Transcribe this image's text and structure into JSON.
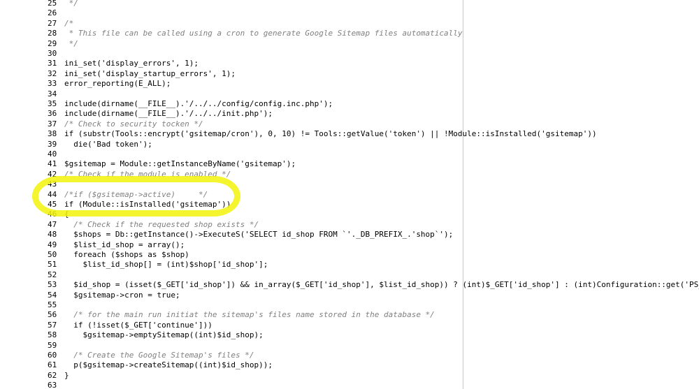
{
  "editor": {
    "lines": [
      {
        "n": "25",
        "text": " */"
      },
      {
        "n": "26",
        "text": ""
      },
      {
        "n": "27",
        "text": "/*"
      },
      {
        "n": "28",
        "text": " * This file can be called using a cron to generate Google Sitemap files automatically"
      },
      {
        "n": "29",
        "text": " */"
      },
      {
        "n": "30",
        "text": ""
      },
      {
        "n": "31",
        "text": "ini_set('display_errors', 1);"
      },
      {
        "n": "32",
        "text": "ini_set('display_startup_errors', 1);"
      },
      {
        "n": "33",
        "text": "error_reporting(E_ALL);"
      },
      {
        "n": "34",
        "text": ""
      },
      {
        "n": "35",
        "text": "include(dirname(__FILE__).'/../../config/config.inc.php');"
      },
      {
        "n": "36",
        "text": "include(dirname(__FILE__).'/../../init.php');"
      },
      {
        "n": "37",
        "text": "/* Check to security tocken */"
      },
      {
        "n": "38",
        "text": "if (substr(Tools::encrypt('gsitemap/cron'), 0, 10) != Tools::getValue('token') || !Module::isInstalled('gsitemap'))"
      },
      {
        "n": "39",
        "text": "  die('Bad token');"
      },
      {
        "n": "40",
        "text": ""
      },
      {
        "n": "41",
        "text": "$gsitemap = Module::getInstanceByName('gsitemap');"
      },
      {
        "n": "42",
        "text": "/* Check if the module is enabled */"
      },
      {
        "n": "43",
        "text": ""
      },
      {
        "n": "44",
        "text": "/*if ($gsitemap->active)     */"
      },
      {
        "n": "45",
        "text": "if (Module::isInstalled('gsitemap'))"
      },
      {
        "n": "46",
        "text": "{"
      },
      {
        "n": "47",
        "text": "  /* Check if the requested shop exists */"
      },
      {
        "n": "48",
        "text": "  $shops = Db::getInstance()->ExecuteS('SELECT id_shop FROM `'._DB_PREFIX_.'shop`');"
      },
      {
        "n": "49",
        "text": "  $list_id_shop = array();"
      },
      {
        "n": "50",
        "text": "  foreach ($shops as $shop)"
      },
      {
        "n": "51",
        "text": "    $list_id_shop[] = (int)$shop['id_shop'];"
      },
      {
        "n": "52",
        "text": ""
      },
      {
        "n": "53",
        "text": "  $id_shop = (isset($_GET['id_shop']) && in_array($_GET['id_shop'], $list_id_shop)) ? (int)$_GET['id_shop'] : (int)Configuration::get('PS_SHOP_DE"
      },
      {
        "n": "54",
        "text": "  $gsitemap->cron = true;"
      },
      {
        "n": "55",
        "text": ""
      },
      {
        "n": "56",
        "text": "  /* for the main run initiat the sitemap's files name stored in the database */"
      },
      {
        "n": "57",
        "text": "  if (!isset($_GET['continue']))"
      },
      {
        "n": "58",
        "text": "    $gsitemap->emptySitemap((int)$id_shop);"
      },
      {
        "n": "59",
        "text": ""
      },
      {
        "n": "60",
        "text": "  /* Create the Google Sitemap's files */"
      },
      {
        "n": "61",
        "text": "  p($gsitemap->createSitemap((int)$id_shop));"
      },
      {
        "n": "62",
        "text": "}"
      },
      {
        "n": "63",
        "text": ""
      }
    ]
  }
}
